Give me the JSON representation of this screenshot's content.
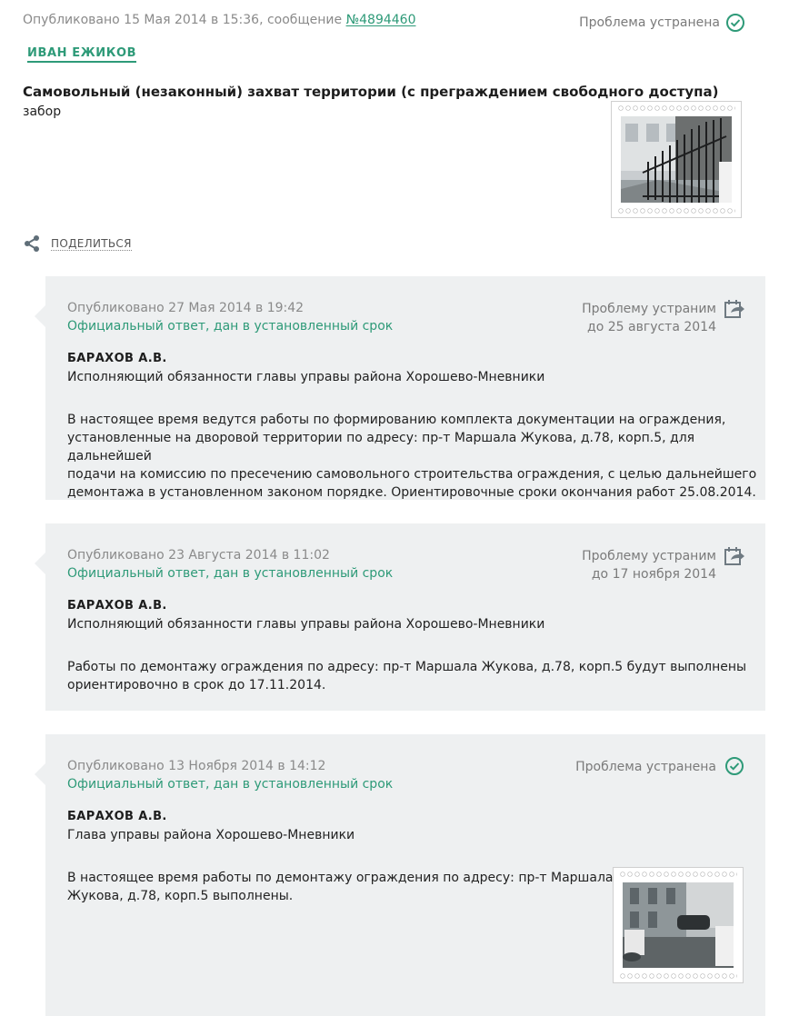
{
  "issue": {
    "published_prefix": "Опубликовано 15 Мая 2014 в 15:36, сообщение ",
    "message_link": "№4894460",
    "status": "Проблема устранена",
    "author": "ИВАН ЕЖИКОВ",
    "title": "Самовольный (незаконный) захват территории (с преграждением свободного доступа)",
    "subtitle": "забор"
  },
  "share": {
    "label": "ПОДЕЛИТЬСЯ",
    "icon": "share-icon"
  },
  "replies": [
    {
      "published": "Опубликовано 27 Мая 2014 в 19:42",
      "official": "Официальный ответ, дан в установленный срок",
      "status_line1": "Проблему устраним",
      "status_line2": "до 25 августа 2014",
      "status_icon": "calendar-forward-icon",
      "name": "БАРАХОВ А.В.",
      "position": "Исполняющий обязанности главы управы района Хорошево-Мневники",
      "text_lines": [
        "В настоящее время ведутся работы по формированию комплекта документации на ограждения,",
        "установленные на дворовой территории по адресу: пр-т Маршала Жукова, д.78, корп.5, для дальнейшей",
        "подачи на комиссию по пресечению самовольного строительства ограждения, с целью дальнейшего",
        "демонтажа в установленном законом порядке. Ориентировочные сроки окончания работ 25.08.2014."
      ]
    },
    {
      "published": "Опубликовано 23 Августа 2014 в 11:02",
      "official": "Официальный ответ, дан в установленный срок",
      "status_line1": "Проблему устраним",
      "status_line2": "до 17 ноября 2014",
      "status_icon": "calendar-forward-icon",
      "name": "БАРАХОВ А.В.",
      "position": "Исполняющий обязанности главы управы района Хорошево-Мневники",
      "text_lines": [
        "Работы по демонтажу ограждения по адресу: пр-т Маршала Жукова, д.78, корп.5 будут выполнены",
        "ориентировочно в срок до 17.11.2014."
      ]
    },
    {
      "published": "Опубликовано 13 Ноября 2014 в 14:12",
      "official": "Официальный ответ, дан в установленный срок",
      "status_line1": "Проблема устранена",
      "status_icon": "check-circle-icon",
      "name": "БАРАХОВ А.В.",
      "position": "Глава управы района Хорошево-Мневники",
      "text_lines": [
        "В настоящее время работы по демонтажу ограждения по адресу: пр-т Маршала",
        "Жукова, д.78, корп.5 выполнены."
      ]
    }
  ],
  "colors": {
    "accent": "#2e9a78",
    "reply_bg": "#eef0f1",
    "muted_text": "#8a8a8a"
  }
}
